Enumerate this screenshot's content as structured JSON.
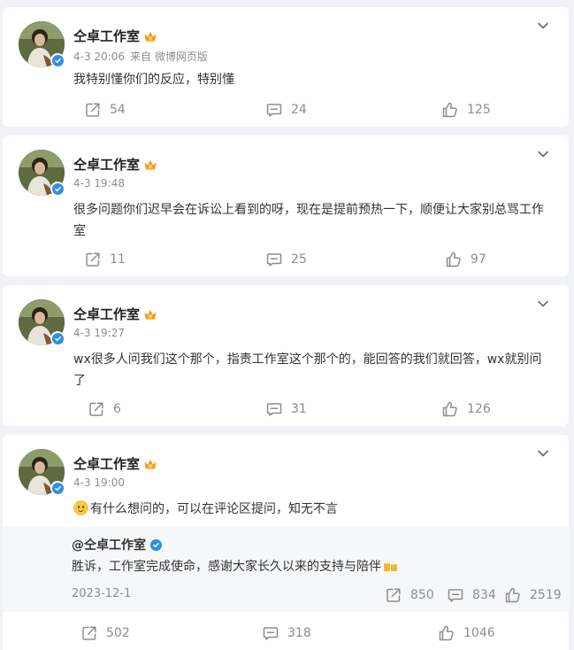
{
  "colors": {
    "page_bg": "#f1f2f5",
    "card_bg": "#ffffff",
    "text": "#333333",
    "muted": "#8d8d8d",
    "verified_blue": "#2f8fe5",
    "crown_orange": "#f59a23",
    "retweet_bg": "#f6f7f9"
  },
  "icons": {
    "more": "chevron-down-icon",
    "repost": "repost-icon",
    "comment": "comment-icon",
    "like": "thumbs-up-icon",
    "verified": "verified-check-icon",
    "member": "crown-icon"
  },
  "posts": [
    {
      "author": "仝卓工作室",
      "time": "4-3 20:06",
      "source": "来自 微博网页版",
      "text": "我特别懂你们的反应，特别懂",
      "reposts": "54",
      "comments": "24",
      "likes": "125"
    },
    {
      "author": "仝卓工作室",
      "time": "4-3 19:48",
      "source": "",
      "text": "很多问题你们迟早会在诉讼上看到的呀，现在是提前预热一下，顺便让大家别总骂工作室",
      "reposts": "11",
      "comments": "25",
      "likes": "97"
    },
    {
      "author": "仝卓工作室",
      "time": "4-3 19:27",
      "source": "",
      "text": "wx很多人问我们这个那个，指责工作室这个那个的，能回答的我们就回答，wx就别问了",
      "reposts": "6",
      "comments": "31",
      "likes": "126"
    },
    {
      "author": "仝卓工作室",
      "time": "4-3 19:00",
      "source": "",
      "text": "有什么想问的，可以在评论区提问，知无不言",
      "reposts": "502",
      "comments": "318",
      "likes": "1046",
      "retweet": {
        "author": "@仝卓工作室",
        "text": "胜诉，工作室完成使命，感谢大家长久以来的支持与陪伴",
        "date": "2023-12-1",
        "reposts": "850",
        "comments": "834",
        "likes": "2519"
      }
    }
  ]
}
